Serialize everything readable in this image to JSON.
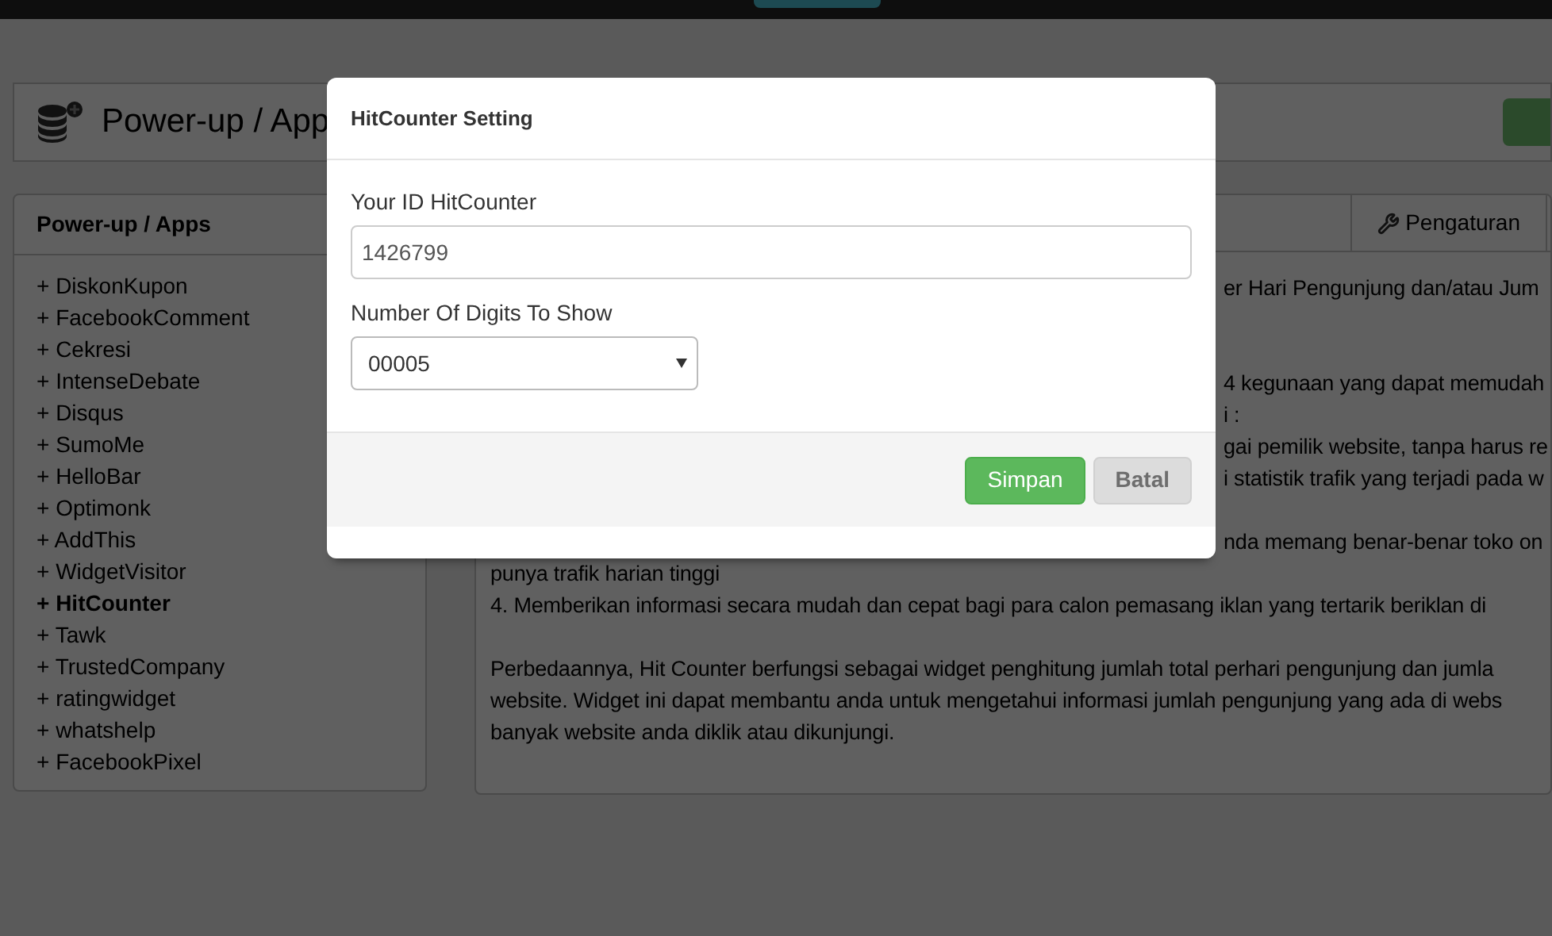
{
  "page_header": {
    "title": "Power-up / App"
  },
  "sidebar": {
    "title": "Power-up / Apps",
    "items": [
      {
        "label": "+ DiskonKupon",
        "selected": false
      },
      {
        "label": "+ FacebookComment",
        "selected": false
      },
      {
        "label": "+ Cekresi",
        "selected": false
      },
      {
        "label": "+ IntenseDebate",
        "selected": false
      },
      {
        "label": "+ Disqus",
        "selected": false
      },
      {
        "label": "+ SumoMe",
        "selected": false
      },
      {
        "label": "+ HelloBar",
        "selected": false
      },
      {
        "label": "+ Optimonk",
        "selected": false
      },
      {
        "label": "+ AddThis",
        "selected": false
      },
      {
        "label": "+ WidgetVisitor",
        "selected": false
      },
      {
        "label": "+ HitCounter",
        "selected": true
      },
      {
        "label": "+ Tawk",
        "selected": false
      },
      {
        "label": "+ TrustedCompany",
        "selected": false
      },
      {
        "label": "+ ratingwidget",
        "selected": false
      },
      {
        "label": "+ whatshelp",
        "selected": false
      },
      {
        "label": "+ FacebookPixel",
        "selected": false
      }
    ]
  },
  "main_panel": {
    "tabs": [
      {
        "label": "Pengaturan"
      }
    ],
    "lines": [
      {
        "kind": "visible_part",
        "text": "er Hari Pengunjung dan/atau Jum"
      },
      {
        "kind": "blank"
      },
      {
        "kind": "blank"
      },
      {
        "kind": "visible_part",
        "text": "4 kegunaan yang dapat memudah"
      },
      {
        "kind": "visible_part",
        "text": "i :"
      },
      {
        "kind": "visible_part",
        "text": "gai pemilik website, tanpa harus re"
      },
      {
        "kind": "visible_part",
        "text": "i statistik trafik yang terjadi pada w"
      },
      {
        "kind": "blank"
      },
      {
        "kind": "visible_part",
        "text": "nda memang benar-benar toko on"
      },
      {
        "kind": "line",
        "text": "punya trafik harian tinggi"
      },
      {
        "kind": "line",
        "text": "4. Memberikan informasi secara mudah dan cepat bagi para calon pemasang iklan yang tertarik beriklan di"
      },
      {
        "kind": "blank"
      },
      {
        "kind": "line",
        "text": "Perbedaannya, Hit Counter berfungsi sebagai widget penghitung jumlah total perhari pengunjung dan jumla"
      },
      {
        "kind": "line",
        "text": "website. Widget ini dapat membantu anda untuk mengetahui informasi jumlah pengunjung yang ada di webs"
      },
      {
        "kind": "line",
        "text": "banyak website anda diklik atau dikunjungi."
      }
    ]
  },
  "dialog": {
    "title": "HitCounter Setting",
    "fields": [
      {
        "kind": "text",
        "label": "Your ID HitCounter",
        "value": "1426799"
      },
      {
        "kind": "select",
        "label": "Number Of Digits To Show",
        "value": "00005"
      }
    ],
    "buttons": [
      {
        "label": "Simpan",
        "kind": "primary",
        "disabled": false
      },
      {
        "label": "Batal",
        "kind": "default",
        "disabled": true
      }
    ]
  }
}
